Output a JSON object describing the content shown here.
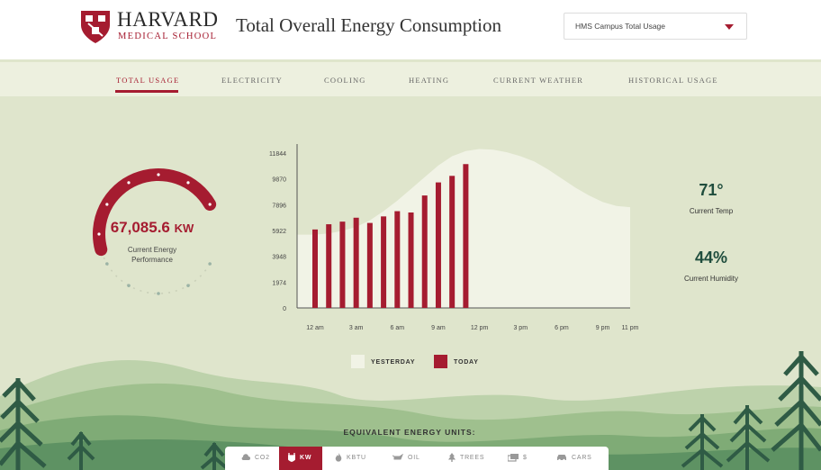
{
  "header": {
    "logo_main": "HARVARD",
    "logo_sub": "MEDICAL SCHOOL",
    "title": "Total Overall Energy Consumption",
    "selector_value": "HMS Campus Total Usage"
  },
  "nav": {
    "tabs": [
      {
        "label": "TOTAL USAGE",
        "active": true
      },
      {
        "label": "ELECTRICITY",
        "active": false
      },
      {
        "label": "COOLING",
        "active": false
      },
      {
        "label": "HEATING",
        "active": false
      },
      {
        "label": "CURRENT WEATHER",
        "active": false
      },
      {
        "label": "HISTORICAL USAGE",
        "active": false
      }
    ]
  },
  "gauge": {
    "value": "67,085.6",
    "unit": "KW",
    "caption_line1": "Current Energy",
    "caption_line2": "Performance",
    "fill_fraction": 0.55
  },
  "chart_data": {
    "type": "bar",
    "y_ticks": [
      0,
      1974,
      3948,
      5922,
      7896,
      9870,
      11844
    ],
    "ylim": [
      0,
      11844
    ],
    "x_tick_labels": [
      "12 am",
      "3 am",
      "6 am",
      "9 am",
      "12 pm",
      "3 pm",
      "6 pm",
      "9 pm",
      "11 pm"
    ],
    "x_range_hours": [
      0,
      23
    ],
    "grid": false,
    "legend_position": "bottom",
    "series": [
      {
        "name": "YESTERDAY",
        "kind": "area",
        "color": "#f1f3e6",
        "hours": [
          0,
          1,
          2,
          3,
          4,
          5,
          6,
          7,
          8,
          9,
          10,
          11,
          12,
          13,
          14,
          15,
          16,
          17,
          18,
          19,
          20,
          21,
          22,
          23
        ],
        "values": [
          5600,
          5700,
          5900,
          6200,
          6700,
          7400,
          8200,
          9100,
          10000,
          10900,
          11600,
          12000,
          12150,
          12100,
          11900,
          11600,
          11200,
          10600,
          9900,
          9200,
          8600,
          8100,
          7800,
          7700
        ]
      },
      {
        "name": "TODAY",
        "kind": "bar",
        "color": "#a51c30",
        "hours": [
          0,
          1,
          2,
          3,
          4,
          5,
          6,
          7,
          8,
          9,
          10,
          11
        ],
        "values": [
          6000,
          6400,
          6600,
          6900,
          6500,
          7000,
          7400,
          7300,
          8600,
          9600,
          10100,
          11000
        ]
      }
    ]
  },
  "legend": {
    "yesterday_label": "YESTERDAY",
    "today_label": "TODAY"
  },
  "weather": {
    "temp_value": "71°",
    "temp_label": "Current Temp",
    "humidity_value": "44%",
    "humidity_label": "Current Humidity"
  },
  "units": {
    "title": "EQUIVALENT ENERGY UNITS:",
    "items": [
      {
        "label": "CO2",
        "icon": "cloud-icon",
        "active": false
      },
      {
        "label": "KW",
        "icon": "plug-icon",
        "active": true
      },
      {
        "label": "KBTU",
        "icon": "flame-icon",
        "active": false
      },
      {
        "label": "OIL",
        "icon": "oil-can-icon",
        "active": false
      },
      {
        "label": "TREES",
        "icon": "tree-icon",
        "active": false
      },
      {
        "label": "$",
        "icon": "money-icon",
        "active": false
      },
      {
        "label": "CARS",
        "icon": "car-icon",
        "active": false
      }
    ]
  },
  "colors": {
    "accent": "#a51c30",
    "background": "#dfe5cc",
    "stat": "#1f4d3d"
  }
}
